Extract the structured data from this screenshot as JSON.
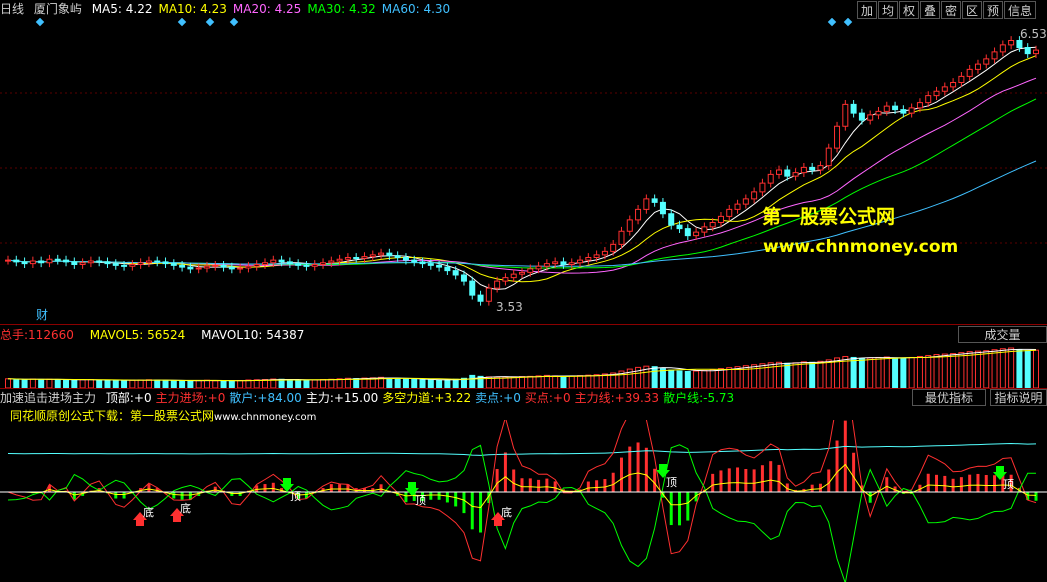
{
  "header": {
    "period": "日线",
    "stock_name": "厦门象屿",
    "ma": [
      {
        "label": "MA5:",
        "value": "4.22",
        "color": "#ffffff"
      },
      {
        "label": "MA10:",
        "value": "4.23",
        "color": "#ffff00"
      },
      {
        "label": "MA20:",
        "value": "4.25",
        "color": "#ff66ff"
      },
      {
        "label": "MA30:",
        "value": "4.32",
        "color": "#00ff00"
      },
      {
        "label": "MA60:",
        "value": "4.30",
        "color": "#40c0ff"
      }
    ],
    "buttons": [
      "加",
      "均",
      "权",
      "叠",
      "密",
      "区",
      "预",
      "信息"
    ]
  },
  "price_panel": {
    "high_label": "6.53",
    "low_label": "3.53",
    "cai_label": "财",
    "watermark_cn": "第一股票公式网",
    "watermark_url": "www.chnmoney.com"
  },
  "volume_panel": {
    "total_label": "总手:",
    "total_value": "112660",
    "mavol5_label": "MAVOL5:",
    "mavol5_value": "56524",
    "mavol10_label": "MAVOL10:",
    "mavol10_value": "54387",
    "button": "成交量"
  },
  "indicator_panel": {
    "name": "加速追击进场主力",
    "fields": [
      {
        "label": "顶部:",
        "value": "+0",
        "color": "#ffffff"
      },
      {
        "label": "主力进场:",
        "value": "+0",
        "color": "#ff3030"
      },
      {
        "label": "散户:",
        "value": "+84.00",
        "color": "#40c0ff"
      },
      {
        "label": "主力:",
        "value": "+15.00",
        "color": "#ffffff"
      },
      {
        "label": "多空力道:",
        "value": "+3.22",
        "color": "#ffff00"
      },
      {
        "label": "卖点:",
        "value": "+0",
        "color": "#40c0ff"
      },
      {
        "label": "买点:",
        "value": "+0",
        "color": "#ff3030"
      },
      {
        "label": "主力线:",
        "value": "+39.33",
        "color": "#ff3030"
      },
      {
        "label": "散户线:",
        "value": "-5.73",
        "color": "#00ff00"
      }
    ],
    "subtitle": "同花顺原创公式下载：第一股票公式网",
    "subtitle_url": "www.chnmoney.com",
    "btn_best": "最优指标",
    "btn_help": "指标说明",
    "markers": [
      {
        "text": "底",
        "type": "bottom"
      },
      {
        "text": "底",
        "type": "bottom"
      },
      {
        "text": "顶",
        "type": "top"
      },
      {
        "text": "顶",
        "type": "top"
      },
      {
        "text": "底",
        "type": "bottom"
      },
      {
        "text": "顶",
        "type": "top"
      },
      {
        "text": "顶",
        "type": "top"
      }
    ]
  },
  "chart_data": {
    "type": "candlestick",
    "price_range": [
      3.53,
      6.53
    ],
    "closes": [
      4.02,
      4.0,
      3.98,
      4.01,
      3.99,
      4.03,
      4.02,
      4.0,
      3.97,
      3.99,
      4.01,
      4.0,
      3.98,
      3.96,
      3.95,
      3.97,
      3.99,
      4.01,
      4.0,
      3.98,
      3.96,
      3.94,
      3.92,
      3.93,
      3.95,
      3.96,
      3.94,
      3.92,
      3.93,
      3.95,
      3.97,
      3.99,
      4.02,
      4.0,
      3.98,
      3.96,
      3.95,
      3.97,
      3.99,
      4.01,
      4.03,
      4.05,
      4.04,
      4.06,
      4.08,
      4.1,
      4.07,
      4.05,
      4.02,
      4.0,
      3.98,
      3.96,
      3.94,
      3.9,
      3.85,
      3.78,
      3.62,
      3.55,
      3.7,
      3.78,
      3.82,
      3.86,
      3.88,
      3.92,
      3.95,
      3.98,
      4.0,
      3.97,
      3.99,
      4.02,
      4.05,
      4.08,
      4.12,
      4.2,
      4.35,
      4.48,
      4.6,
      4.72,
      4.68,
      4.55,
      4.42,
      4.38,
      4.3,
      4.34,
      4.4,
      4.45,
      4.52,
      4.6,
      4.66,
      4.72,
      4.8,
      4.9,
      5.0,
      5.05,
      4.98,
      5.02,
      5.08,
      5.05,
      5.1,
      5.3,
      5.55,
      5.8,
      5.7,
      5.62,
      5.68,
      5.72,
      5.78,
      5.74,
      5.7,
      5.76,
      5.82,
      5.9,
      5.95,
      6.0,
      6.05,
      6.12,
      6.2,
      6.26,
      6.32,
      6.4,
      6.48,
      6.53,
      6.45,
      6.38,
      6.42
    ],
    "volume": [
      38,
      36,
      35,
      37,
      34,
      36,
      35,
      33,
      32,
      34,
      35,
      33,
      32,
      31,
      30,
      32,
      33,
      34,
      33,
      31,
      30,
      29,
      30,
      31,
      32,
      30,
      29,
      30,
      31,
      33,
      34,
      35,
      37,
      36,
      34,
      33,
      32,
      33,
      35,
      36,
      38,
      40,
      39,
      41,
      42,
      44,
      41,
      39,
      37,
      35,
      34,
      33,
      32,
      34,
      36,
      40,
      52,
      48,
      46,
      44,
      45,
      46,
      47,
      48,
      50,
      52,
      50,
      48,
      49,
      51,
      53,
      55,
      58,
      62,
      70,
      78,
      85,
      90,
      88,
      80,
      74,
      70,
      68,
      70,
      72,
      76,
      80,
      84,
      88,
      92,
      96,
      100,
      104,
      106,
      102,
      104,
      108,
      106,
      110,
      116,
      124,
      130,
      126,
      122,
      124,
      126,
      128,
      124,
      122,
      126,
      130,
      134,
      138,
      140,
      142,
      146,
      150,
      152,
      154,
      158,
      162,
      165,
      158,
      154,
      156
    ],
    "mavol5": "56524",
    "mavol10": "54387"
  }
}
